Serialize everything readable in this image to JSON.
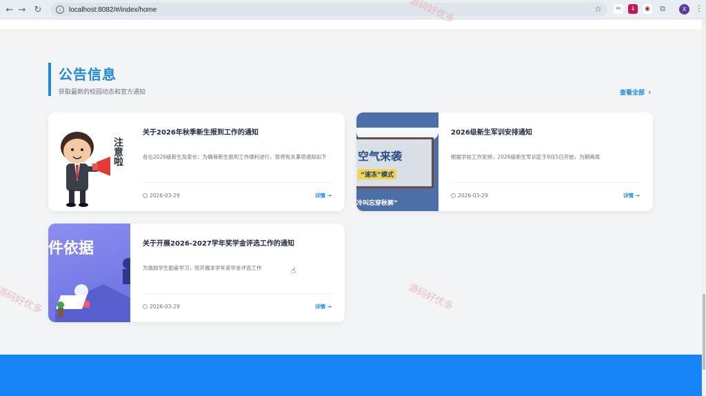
{
  "browser": {
    "url": "localhost:8082/#/index/home",
    "avatar_letter": "X"
  },
  "section": {
    "title": "公告信息",
    "subtitle": "获取最新的校园动态和官方通知",
    "view_all": "查看全部"
  },
  "announcements": [
    {
      "title": "关于2026年秋季新生报到工作的通知",
      "desc": "各位2026级新生及家长：为确保新生报到工作顺利进行，现将有关事项通知如下",
      "date": "2026-03-29",
      "detail": "详情 →",
      "thumb_text": "注意啦"
    },
    {
      "title": "2026级新生军训安排通知",
      "desc": "根据学校工作安排，2026级新生军训定于9月5日开始，为期两周",
      "date": "2026-03-29",
      "detail": "详情 →",
      "thumb_text": "空气来袭",
      "thumb_sub": "“速冻”模式",
      "thumb_bottom": "冷叫忘穿秋裤”"
    },
    {
      "title": "关于开展2026-2027学年奖学金评选工作的通知",
      "desc": "为激励学生勤奋学习，现开展本学年奖学金评选工作",
      "date": "2026-03-29",
      "detail": "详情 →",
      "thumb_text": "件依据"
    }
  ],
  "watermark": "源码好优多",
  "colors": {
    "accent": "#1e88e5",
    "footer": "#1784f7",
    "page_bg": "#f3f4f6"
  }
}
